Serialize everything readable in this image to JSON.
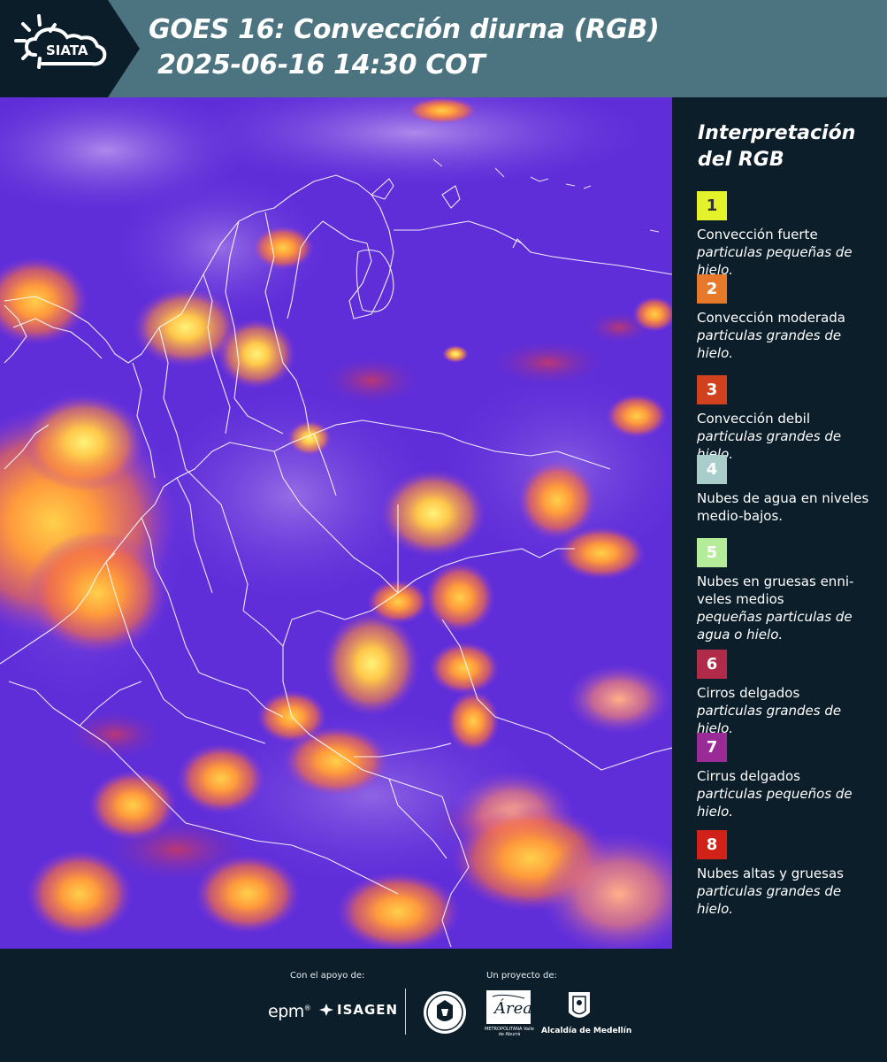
{
  "header": {
    "logo_text": "SIATA",
    "title_line1": "GOES 16: Convección diurna (RGB)",
    "title_line2": " 2025-06-16 14:30 COT"
  },
  "legend": {
    "title": "Interpretación del RGB",
    "items": [
      {
        "number": "1",
        "color": "#e4f22a",
        "text_color": "#333333",
        "name": "Convección fuerte",
        "desc": "particulas pequeñas de hielo."
      },
      {
        "number": "2",
        "color": "#e6792a",
        "text_color": "#ffffff",
        "name": "Convección moderada",
        "desc": "particulas grandes de hielo."
      },
      {
        "number": "3",
        "color": "#d2411e",
        "text_color": "#ffffff",
        "name": "Convección debil",
        "desc": "particulas grandes de hielo."
      },
      {
        "number": "4",
        "color": "#a9cdca",
        "text_color": "#ffffff",
        "name": "Nubes de agua en niveles medio-bajos.",
        "desc": ""
      },
      {
        "number": "5",
        "color": "#b5ec9a",
        "text_color": "#ffffff",
        "name": "Nubes en gruesas enni-veles medios",
        "desc": "pequeñas particulas de agua o hielo."
      },
      {
        "number": "6",
        "color": "#b02b47",
        "text_color": "#ffffff",
        "name": "Cirros delgados",
        "desc": "particulas grandes de hielo."
      },
      {
        "number": "7",
        "color": "#9a2a95",
        "text_color": "#ffffff",
        "name": "Cirrus delgados",
        "desc": "particulas pequeños de hielo."
      },
      {
        "number": "8",
        "color": "#d1221a",
        "text_color": "#ffffff",
        "name": "Nubes altas y gruesas",
        "desc": "particulas grandes de hielo."
      }
    ]
  },
  "map": {
    "base_color": "#5a2bd8",
    "border_color": "#ffffff"
  },
  "footer": {
    "support_label": "Con el apoyo de:",
    "project_label": "Un proyecto de:",
    "sponsor_epm": "epm",
    "sponsor_isagen": "ISAGEN",
    "area_name": "Área",
    "area_caption": "METROPOLITANA Valle de Aburrá",
    "alcaldia": "Alcaldía de Medellín"
  }
}
